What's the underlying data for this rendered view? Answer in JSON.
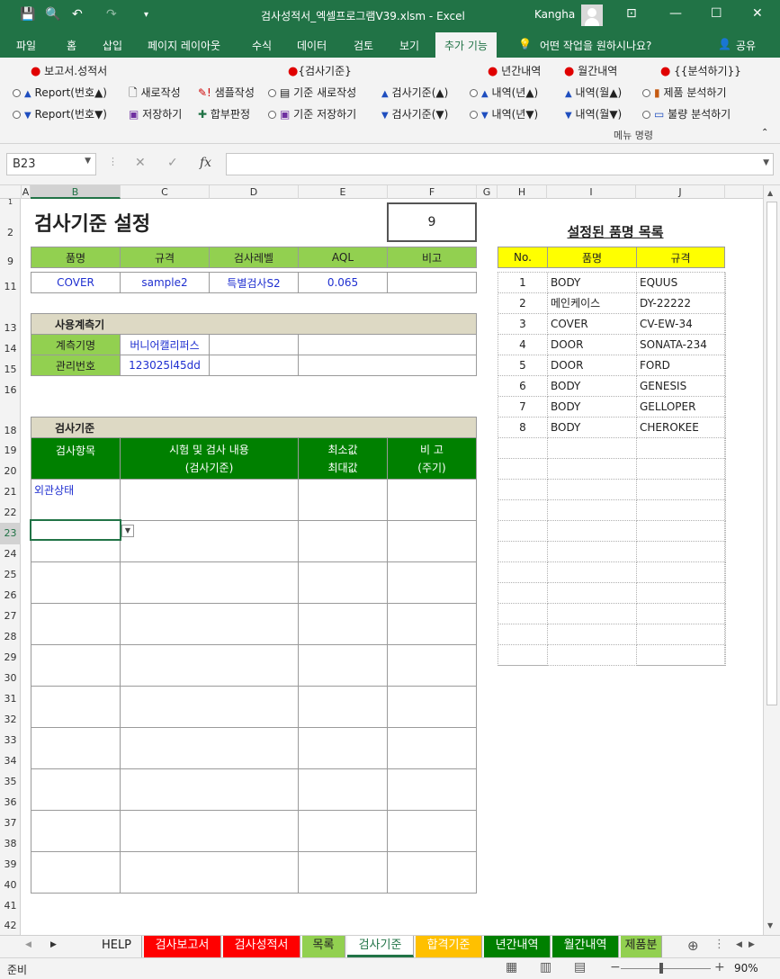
{
  "window": {
    "title": "검사성적서_엑셀프로그램V39.xlsm  -  Excel",
    "user": "Kangha",
    "minimize": "—",
    "maximize": "☐",
    "close": "✕"
  },
  "ribbon_tabs": [
    "파일",
    "홈",
    "삽입",
    "페이지 레이아웃",
    "수식",
    "데이터",
    "검토",
    "보기",
    "추가 기능"
  ],
  "tell_me": "어떤 작업을 원하시나요?",
  "share": "공유",
  "ribbon": {
    "group1_title": "보고서.성적서",
    "report_up": "Report(번호▲)",
    "report_down": "Report(번호▼)",
    "new_create": "새로작성",
    "save": "저장하기",
    "sample_create": "샘플작성",
    "pass_fail": "합부판정",
    "group2_title": "{검사기준}",
    "std_new": "기준 새로작성",
    "std_save": "기준 저장하기",
    "std_up": "검사기준(▲)",
    "std_down": "검사기준(▼)",
    "group3_title": "년간내역",
    "year_up": "내역(년▲)",
    "year_down": "내역(년▼)",
    "group4_title": "월간내역",
    "month_up": "내역(월▲)",
    "month_down": "내역(월▼)",
    "group5_title": "{{분석하기}}",
    "product_analysis": "제품 분석하기",
    "defect_analysis": "불량 분석하기",
    "menu_command": "메뉴 명령"
  },
  "formula_bar": {
    "namebox": "B23",
    "cancel": "✕",
    "enter": "✓",
    "fx": "fx",
    "formula": ""
  },
  "columns": [
    "A",
    "B",
    "C",
    "D",
    "E",
    "F",
    "G",
    "H",
    "I",
    "J"
  ],
  "rows": [
    "1",
    "2",
    "9",
    "11",
    "13",
    "14",
    "15",
    "16",
    "18",
    "19",
    "20",
    "21",
    "22",
    "23",
    "24",
    "25",
    "26",
    "27",
    "28",
    "29",
    "30",
    "31",
    "32",
    "33",
    "34",
    "35",
    "36",
    "37",
    "38",
    "39",
    "40",
    "41",
    "42"
  ],
  "sheet": {
    "title": "검사기준 설정",
    "number": "9",
    "headers": [
      "품명",
      "규격",
      "검사레벨",
      "AQL",
      "비고"
    ],
    "values": [
      "COVER",
      "sample2",
      "특별검사S2",
      "0.065",
      ""
    ],
    "instrument_title": "사용계측기",
    "instrument_name_label": "계측기명",
    "instrument_name": "버니어캘리퍼스",
    "mgmt_no_label": "관리번호",
    "mgmt_no": "123025l45dd",
    "std_title": "검사기준",
    "std_headers": {
      "item": "검사항목",
      "content1": "시험 및 검사 내용",
      "content2": "(검사기준)",
      "minmax1": "최소값",
      "minmax2": "최대값",
      "note1": "비  고",
      "note2": "(주기)"
    },
    "first_item": "외관상태"
  },
  "product_list": {
    "title": "설정된 품명 목록",
    "headers": [
      "No.",
      "품명",
      "규격"
    ],
    "rows": [
      {
        "no": "1",
        "name": "BODY",
        "spec": "EQUUS"
      },
      {
        "no": "2",
        "name": "메인케이스",
        "spec": "DY-22222"
      },
      {
        "no": "3",
        "name": "COVER",
        "spec": "CV-EW-34"
      },
      {
        "no": "4",
        "name": "DOOR",
        "spec": "SONATA-234"
      },
      {
        "no": "5",
        "name": "DOOR",
        "spec": "FORD"
      },
      {
        "no": "6",
        "name": "BODY",
        "spec": "GENESIS"
      },
      {
        "no": "7",
        "name": "BODY",
        "spec": "GELLOPER"
      },
      {
        "no": "8",
        "name": "BODY",
        "spec": "CHEROKEE"
      }
    ]
  },
  "sheet_tabs": [
    {
      "label": "HELP",
      "bg": "#f3f3f3",
      "fg": "#222"
    },
    {
      "label": "검사보고서",
      "bg": "#ff0000",
      "fg": "#fff"
    },
    {
      "label": "검사성적서",
      "bg": "#ff0000",
      "fg": "#fff"
    },
    {
      "label": "목록",
      "bg": "#92d050",
      "fg": "#222"
    },
    {
      "label": "검사기준",
      "bg": "#ffffff",
      "fg": "#217346"
    },
    {
      "label": "합격기준",
      "bg": "#ffc000",
      "fg": "#fff"
    },
    {
      "label": "년간내역",
      "bg": "#008000",
      "fg": "#fff"
    },
    {
      "label": "월간내역",
      "bg": "#008000",
      "fg": "#fff"
    },
    {
      "label": "제품분",
      "bg": "#92d050",
      "fg": "#222"
    }
  ],
  "status": {
    "ready": "준비",
    "zoom": "90%",
    "minus": "−",
    "plus": "+"
  },
  "colors": {
    "excel_green": "#217346",
    "header_light_green": "#92d050",
    "header_dark_green": "#008000",
    "header_tan": "#ddd9c4",
    "list_header_yellow": "#ffff00"
  }
}
